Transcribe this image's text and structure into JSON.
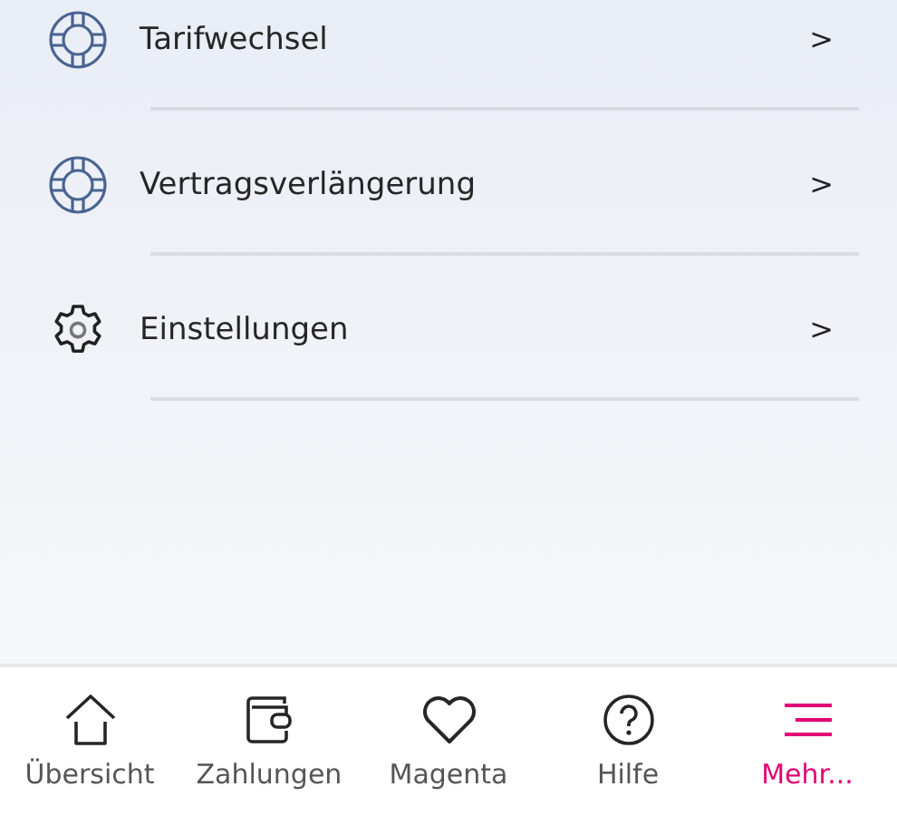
{
  "menu_items": [
    {
      "kind": "lifebuoy",
      "label": "Tarifwechsel",
      "chevron": ">"
    },
    {
      "kind": "lifebuoy",
      "label": "Vertragsverlängerung",
      "chevron": ">"
    },
    {
      "kind": "gear",
      "label": "Einstellungen",
      "chevron": ">"
    }
  ],
  "bottom_nav": [
    {
      "kind": "home",
      "label": "Übersicht",
      "selected": false
    },
    {
      "kind": "wallet",
      "label": "Zahlungen",
      "selected": false
    },
    {
      "kind": "heart",
      "label": "Magenta",
      "selected": false
    },
    {
      "kind": "help",
      "label": "Hilfe",
      "selected": false
    },
    {
      "kind": "menu",
      "label": "Mehr...",
      "selected": true
    }
  ]
}
